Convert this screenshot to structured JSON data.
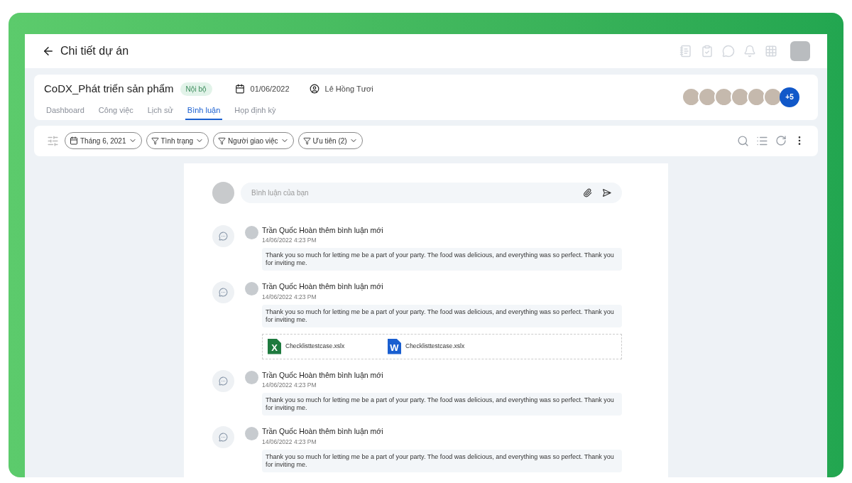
{
  "header": {
    "title": "Chi tiết dự án"
  },
  "project": {
    "name": "CoDX_Phát triển sản phẩm",
    "badge": "Nội bộ",
    "date": "01/06/2022",
    "owner": "Lê Hồng Tươi",
    "members_more": "+5"
  },
  "tabs": [
    {
      "label": "Dashboard",
      "selected": false
    },
    {
      "label": "Công việc",
      "selected": false
    },
    {
      "label": "Lịch sử",
      "selected": false
    },
    {
      "label": "Bình luận",
      "selected": true
    },
    {
      "label": "Họp định kỳ",
      "selected": false
    }
  ],
  "filters": [
    {
      "kind": "date",
      "label": "Tháng 6, 2021"
    },
    {
      "kind": "filter",
      "label": "Tình trạng"
    },
    {
      "kind": "filter",
      "label": "Người giao việc"
    },
    {
      "kind": "filter",
      "label": "Ưu tiên (2)"
    }
  ],
  "composer": {
    "placeholder": "Bình luận của bạn"
  },
  "comments": [
    {
      "author": "Trần Quốc Hoàn",
      "action": "thêm bình luận mới",
      "time": "14/06/2022 4:23 PM",
      "text": "Thank you so much for letting me be a part of your party. The food was delicious, and everything was so perfect. Thank you for inviting me."
    },
    {
      "author": "Trần Quốc Hoàn",
      "action": "thêm bình luận mới",
      "time": "14/06/2022 4:23 PM",
      "text": "Thank you so much for letting me be a part of your party. The food was delicious, and everything was so perfect. Thank you for inviting me.",
      "attachments": [
        {
          "kind": "excel",
          "letter": "X",
          "name": "Checklisttestcase.xslx"
        },
        {
          "kind": "word",
          "letter": "W",
          "name": "Checklisttestcase.xslx"
        }
      ]
    },
    {
      "author": "Trần Quốc Hoàn",
      "action": "thêm bình luận mới",
      "time": "14/06/2022 4:23 PM",
      "text": "Thank you so much for letting me be a part of your party. The food was delicious, and everything was so perfect. Thank you for inviting me."
    },
    {
      "author": "Trần Quốc Hoàn",
      "action": "thêm bình luận mới",
      "time": "14/06/2022 4:23 PM",
      "text": "Thank you so much for letting me be a part of your party. The food was delicious, and everything was so perfect. Thank you for inviting me."
    }
  ]
}
